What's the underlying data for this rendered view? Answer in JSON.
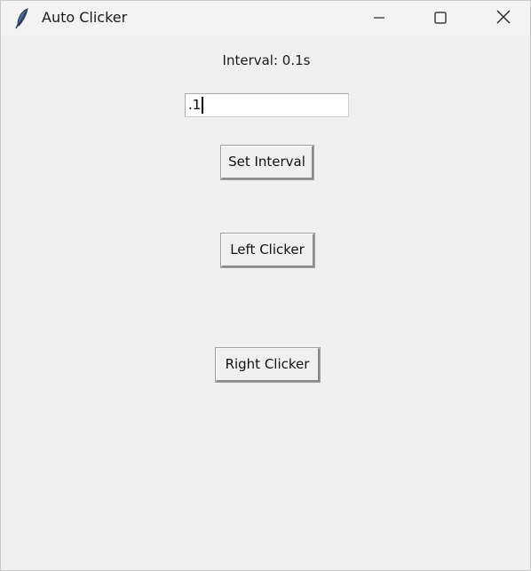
{
  "window": {
    "title": "Auto Clicker",
    "icon": "feather-icon"
  },
  "controls": {
    "minimize_icon": "minimize-icon",
    "maximize_icon": "maximize-icon",
    "close_icon": "close-icon"
  },
  "main": {
    "interval_label": "Interval: 0.1s",
    "interval_input_value": ".1",
    "set_interval_label": "Set Interval",
    "left_clicker_label": "Left Clicker",
    "right_clicker_label": "Right Clicker"
  }
}
